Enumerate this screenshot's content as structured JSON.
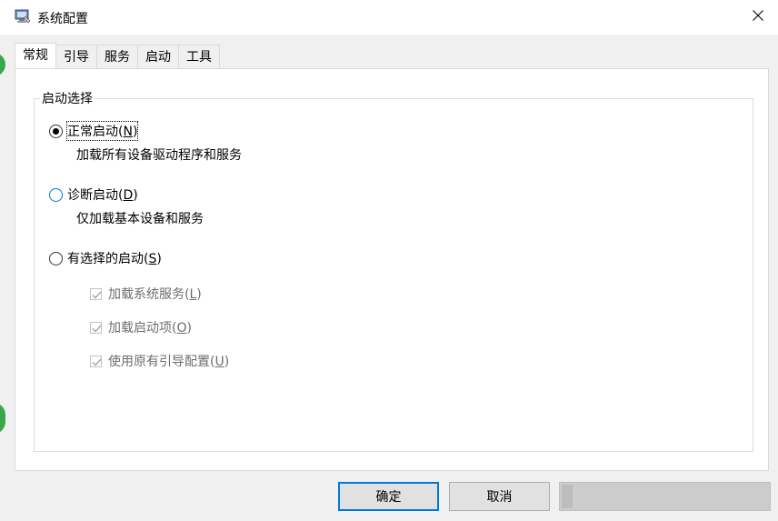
{
  "window": {
    "title": "系统配置"
  },
  "tabs": [
    {
      "label": "常规",
      "active": true
    },
    {
      "label": "引导",
      "active": false
    },
    {
      "label": "服务",
      "active": false
    },
    {
      "label": "启动",
      "active": false
    },
    {
      "label": "工具",
      "active": false
    }
  ],
  "startup_group": {
    "title": "启动选择",
    "normal": {
      "label": "正常启动(",
      "key": "N",
      "suffix": ")",
      "checked": true,
      "description": "加载所有设备驱动程序和服务"
    },
    "diagnostic": {
      "label": "诊断启动(",
      "key": "D",
      "suffix": ")",
      "checked": false,
      "description": "仅加载基本设备和服务"
    },
    "selective": {
      "label": "有选择的启动(",
      "key": "S",
      "suffix": ")",
      "checked": false
    },
    "options": [
      {
        "label": "加载系统服务(",
        "key": "L",
        "suffix": ")",
        "checked": true,
        "enabled": false
      },
      {
        "label": "加载启动项(",
        "key": "O",
        "suffix": ")",
        "checked": true,
        "enabled": false
      },
      {
        "label": "使用原有引导配置(",
        "key": "U",
        "suffix": ")",
        "checked": true,
        "enabled": false
      }
    ]
  },
  "buttons": {
    "ok": "确定",
    "cancel": "取消"
  },
  "icons": {
    "app": "msconfig-icon",
    "close": "close-icon"
  },
  "colors": {
    "accent": "#0078d7",
    "window_bg": "#f0f0f0",
    "panel_bg": "#ffffff",
    "disabled_text": "#6d6d6d"
  }
}
